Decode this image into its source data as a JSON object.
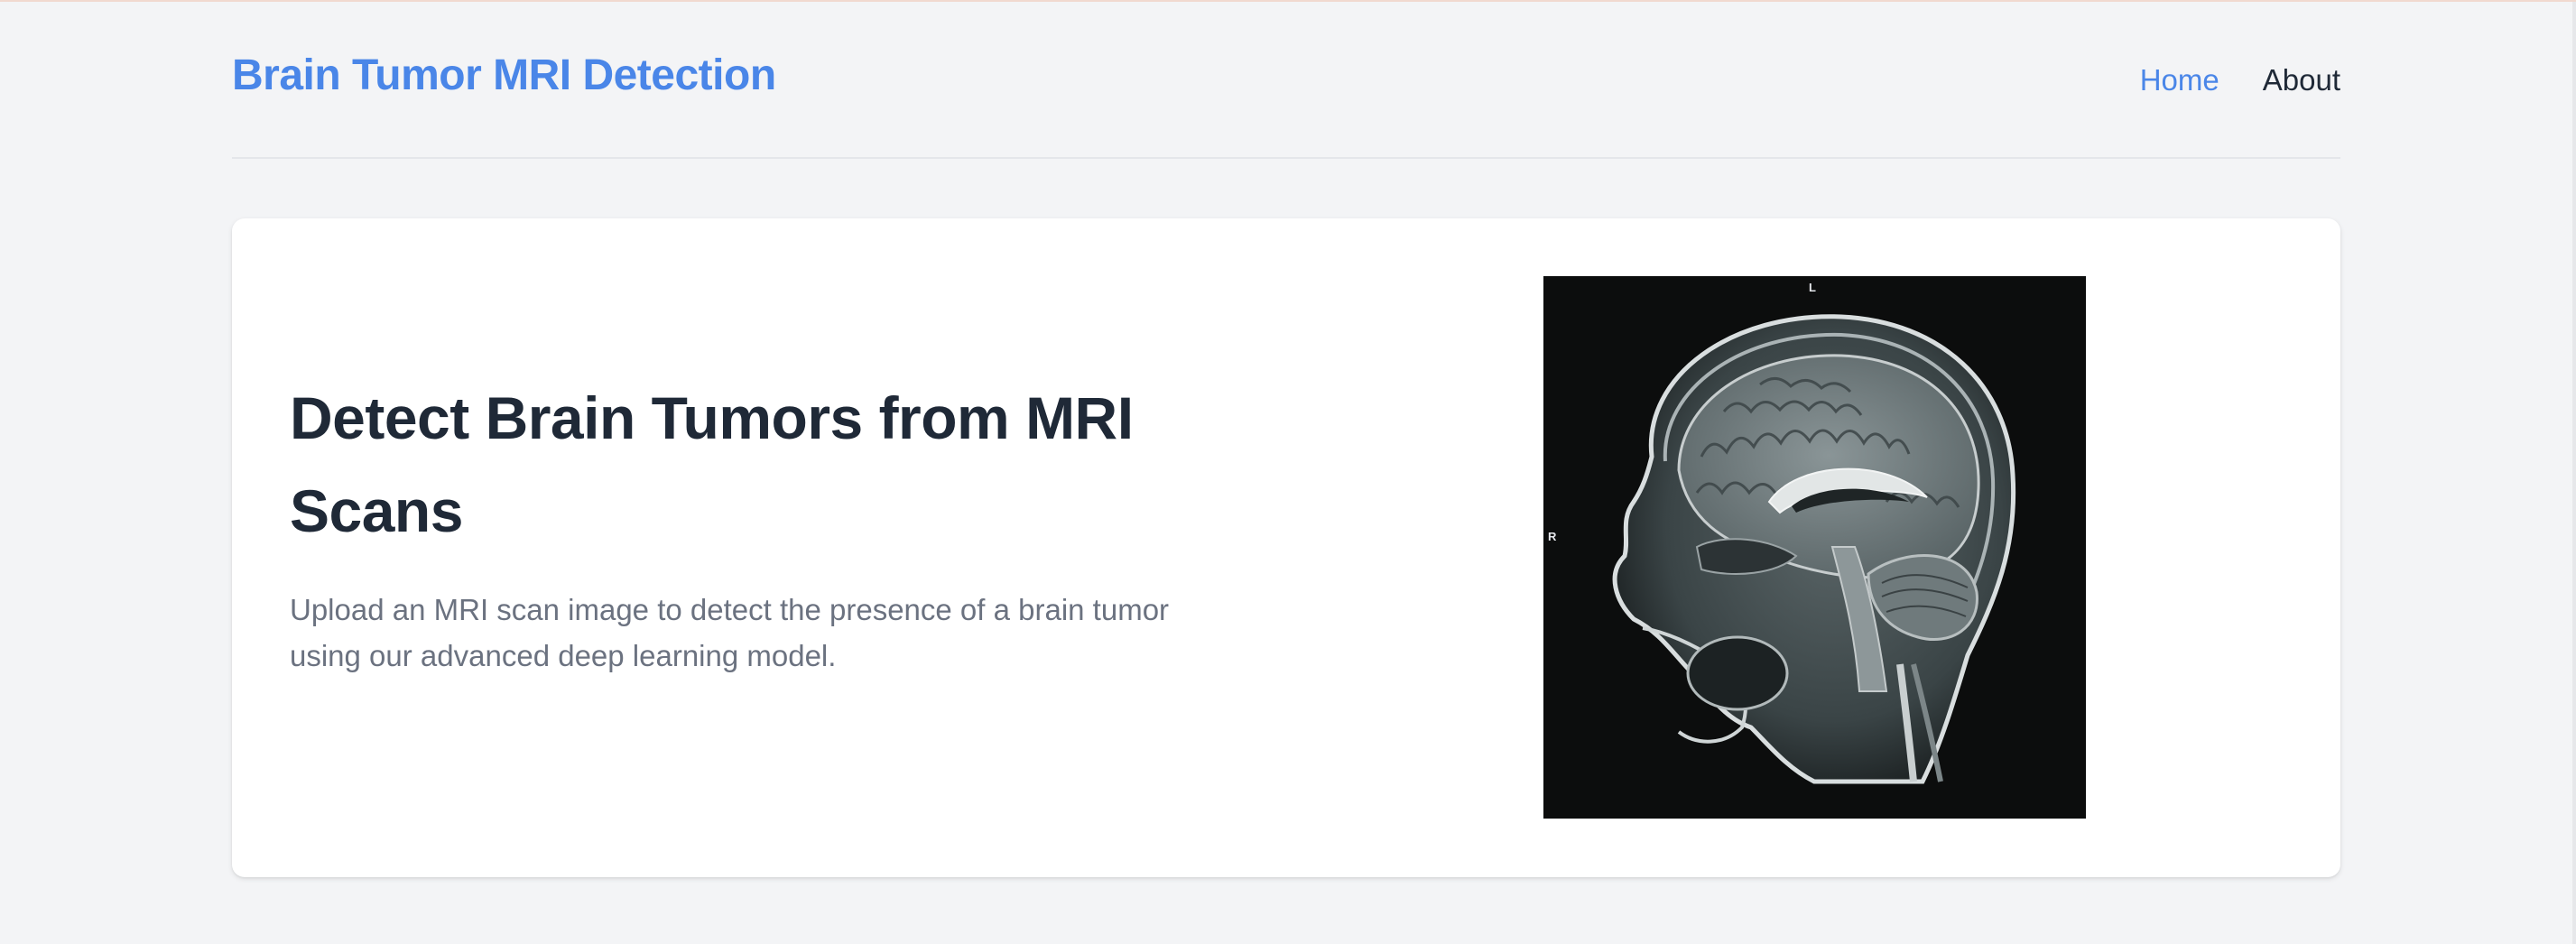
{
  "header": {
    "brand": "Brain Tumor MRI Detection",
    "nav": [
      {
        "label": "Home",
        "active": true
      },
      {
        "label": "About",
        "active": false
      }
    ]
  },
  "hero": {
    "title": "Detect Brain Tumors from MRI Scans",
    "description": "Upload an MRI scan image to detect the presence of a brain tumor using our advanced deep learning model.",
    "image": {
      "icon": "mri-brain-scan-image",
      "top_label": "L",
      "side_label": "R"
    }
  },
  "colors": {
    "accent": "#4a86e8",
    "text_dark": "#1f2937",
    "text_muted": "#6b7280",
    "background": "#f3f4f6",
    "card": "#ffffff"
  }
}
